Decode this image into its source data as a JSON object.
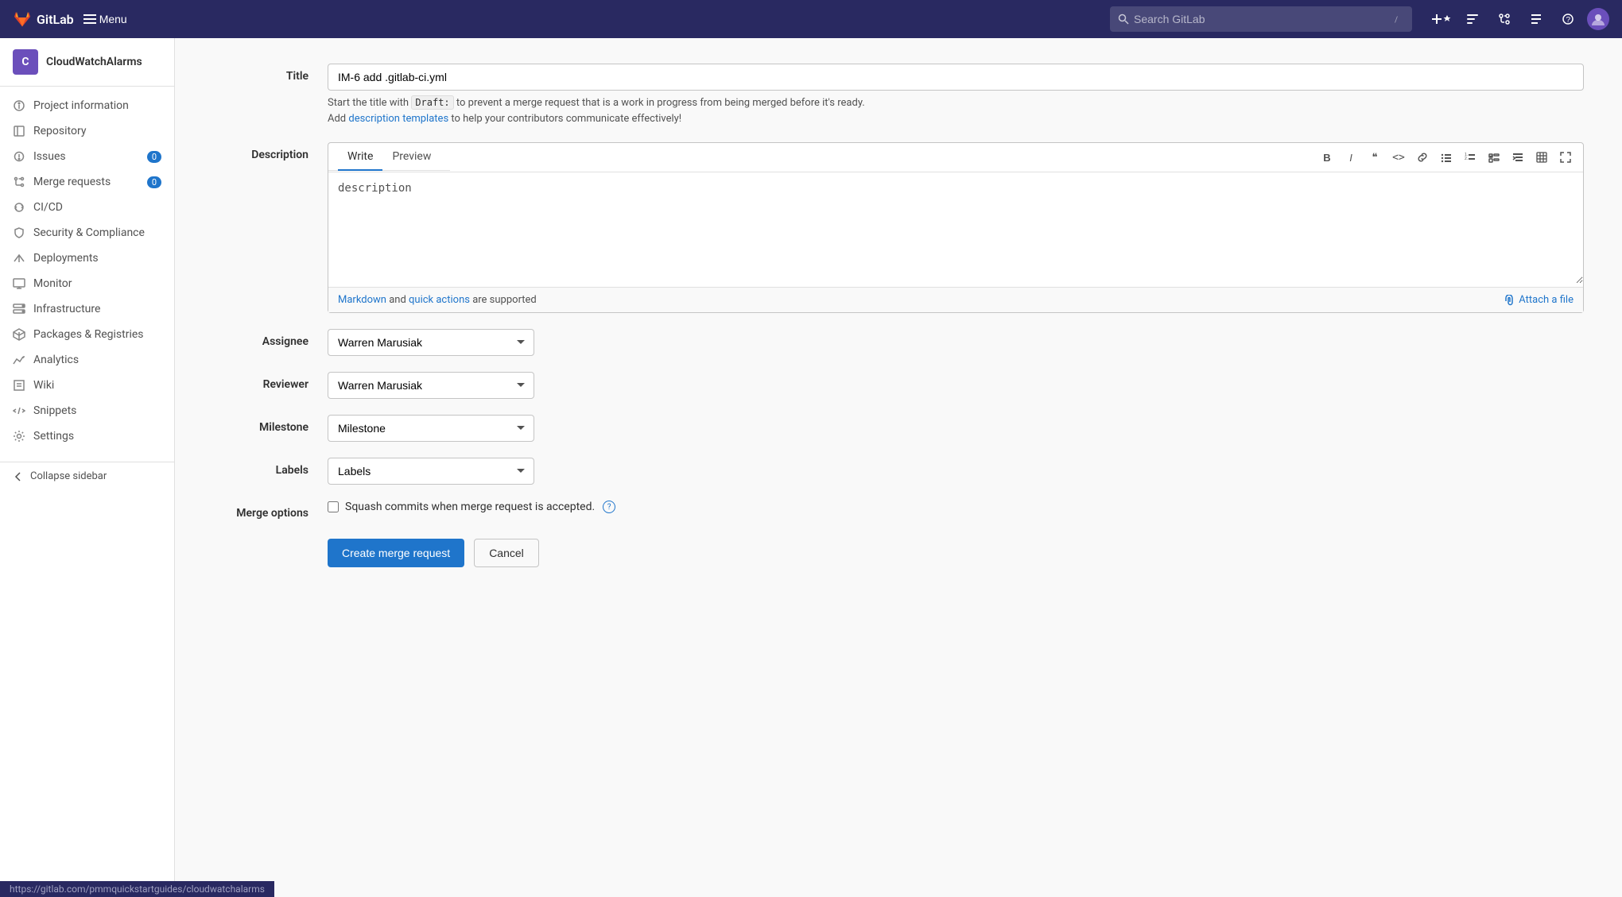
{
  "app": {
    "name": "GitLab",
    "menu_label": "Menu"
  },
  "search": {
    "placeholder": "Search GitLab"
  },
  "project": {
    "initial": "C",
    "name": "CloudWatchAlarms"
  },
  "sidebar": {
    "items": [
      {
        "id": "project-information",
        "label": "Project information",
        "icon": "info",
        "badge": null
      },
      {
        "id": "repository",
        "label": "Repository",
        "icon": "book",
        "badge": null
      },
      {
        "id": "issues",
        "label": "Issues",
        "icon": "issues",
        "badge": "0"
      },
      {
        "id": "merge-requests",
        "label": "Merge requests",
        "icon": "merge",
        "badge": "0"
      },
      {
        "id": "cicd",
        "label": "CI/CD",
        "icon": "cicd",
        "badge": null
      },
      {
        "id": "security",
        "label": "Security & Compliance",
        "icon": "shield",
        "badge": null
      },
      {
        "id": "deployments",
        "label": "Deployments",
        "icon": "deploy",
        "badge": null
      },
      {
        "id": "monitor",
        "label": "Monitor",
        "icon": "monitor",
        "badge": null
      },
      {
        "id": "infrastructure",
        "label": "Infrastructure",
        "icon": "infra",
        "badge": null
      },
      {
        "id": "packages",
        "label": "Packages & Registries",
        "icon": "package",
        "badge": null
      },
      {
        "id": "analytics",
        "label": "Analytics",
        "icon": "analytics",
        "badge": null
      },
      {
        "id": "wiki",
        "label": "Wiki",
        "icon": "wiki",
        "badge": null
      },
      {
        "id": "snippets",
        "label": "Snippets",
        "icon": "snippets",
        "badge": null
      },
      {
        "id": "settings",
        "label": "Settings",
        "icon": "settings",
        "badge": null
      }
    ],
    "collapse_label": "Collapse sidebar"
  },
  "form": {
    "title_label": "Title",
    "title_value": "IM-6 add .gitlab-ci.yml",
    "hint_start": "Start the title with",
    "hint_code": "Draft:",
    "hint_rest": " to prevent a merge request that is a work in progress from being merged before it's ready.",
    "hint_add": "Add ",
    "hint_templates_link": "description templates",
    "hint_end": " to help your contributors communicate effectively!",
    "description_label": "Description",
    "tab_write": "Write",
    "tab_preview": "Preview",
    "description_placeholder": "description",
    "toolbar": {
      "bold": "B",
      "italic": "I",
      "quote": "❝",
      "code": "<>",
      "link": "🔗",
      "bullet": "≡",
      "numbered": "≡",
      "task": "☑",
      "indent": "⇥",
      "table": "⊞",
      "expand": "⛶"
    },
    "markdown_label": "Markdown",
    "quick_actions_label": "quick actions",
    "markdown_rest": " are supported",
    "attach_label": "Attach a file",
    "assignee_label": "Assignee",
    "assignee_value": "Warren Marusiak",
    "reviewer_label": "Reviewer",
    "reviewer_value": "Warren Marusiak",
    "milestone_label": "Milestone",
    "milestone_value": "Milestone",
    "labels_label": "Labels",
    "labels_value": "Labels",
    "merge_options_label": "Merge options",
    "squash_label": "Squash commits when merge request is accepted.",
    "create_btn": "Create merge request",
    "cancel_btn": "Cancel"
  },
  "status_bar": {
    "url": "https://gitlab.com/pmmquickstartguides/cloudwatchalarms"
  }
}
